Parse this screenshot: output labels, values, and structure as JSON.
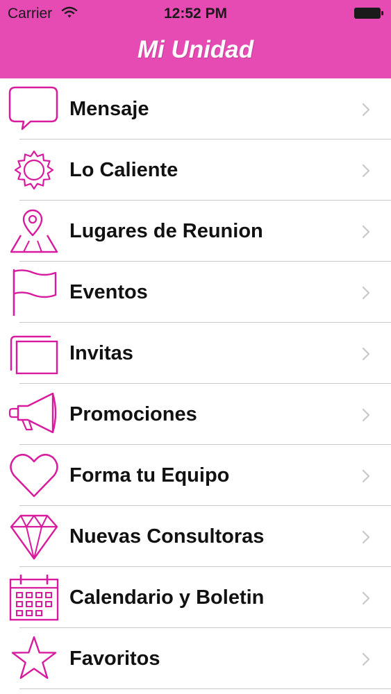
{
  "status_bar": {
    "carrier": "Carrier",
    "time": "12:52 PM"
  },
  "nav": {
    "title": "Mi Unidad"
  },
  "colors": {
    "accent": "#e54bb3",
    "icon": "#d81b9e"
  },
  "menu": {
    "items": [
      {
        "label": "Mensaje",
        "icon": "speech-bubble-icon"
      },
      {
        "label": "Lo Caliente",
        "icon": "sun-icon"
      },
      {
        "label": "Lugares de Reunion",
        "icon": "map-pin-icon"
      },
      {
        "label": "Eventos",
        "icon": "flag-icon"
      },
      {
        "label": "Invitas",
        "icon": "cards-icon"
      },
      {
        "label": "Promociones",
        "icon": "megaphone-icon"
      },
      {
        "label": "Forma tu Equipo",
        "icon": "heart-icon"
      },
      {
        "label": "Nuevas Consultoras",
        "icon": "diamond-icon"
      },
      {
        "label": "Calendario y Boletin",
        "icon": "calendar-icon"
      },
      {
        "label": "Favoritos",
        "icon": "star-icon"
      }
    ]
  }
}
